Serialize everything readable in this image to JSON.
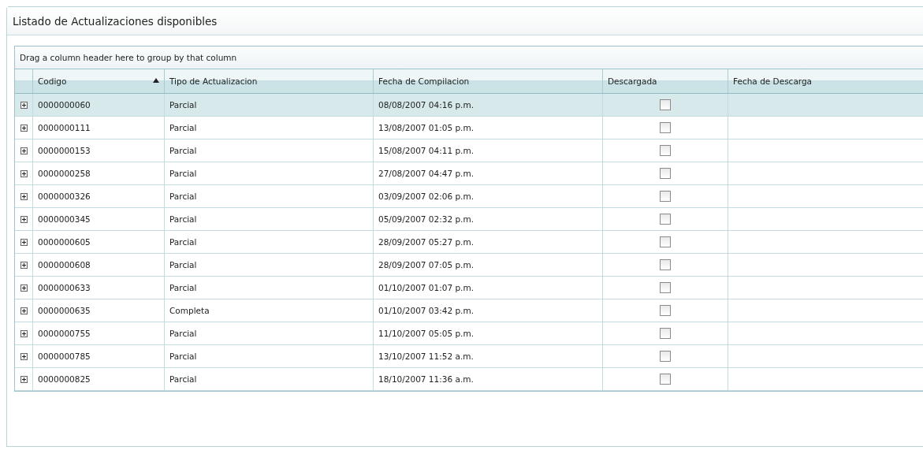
{
  "panel": {
    "title": "Listado de Actualizaciones disponibles"
  },
  "grid": {
    "group_hint": "Drag a column header here to group by that column",
    "columns": [
      {
        "label": "Codigo",
        "sorted": true
      },
      {
        "label": "Tipo de Actualizacion",
        "sorted": false
      },
      {
        "label": "Fecha de Compilacion",
        "sorted": false
      },
      {
        "label": "Descargada",
        "sorted": false
      },
      {
        "label": "Fecha de Descarga",
        "sorted": false
      }
    ],
    "rows": [
      {
        "codigo": "0000000060",
        "tipo": "Parcial",
        "fecha": "08/08/2007 04:16 p.m.",
        "descargada": false,
        "selected": true
      },
      {
        "codigo": "0000000111",
        "tipo": "Parcial",
        "fecha": "13/08/2007 01:05 p.m.",
        "descargada": false,
        "selected": false
      },
      {
        "codigo": "0000000153",
        "tipo": "Parcial",
        "fecha": "15/08/2007 04:11 p.m.",
        "descargada": false,
        "selected": false
      },
      {
        "codigo": "0000000258",
        "tipo": "Parcial",
        "fecha": "27/08/2007 04:47 p.m.",
        "descargada": false,
        "selected": false
      },
      {
        "codigo": "0000000326",
        "tipo": "Parcial",
        "fecha": "03/09/2007 02:06 p.m.",
        "descargada": false,
        "selected": false
      },
      {
        "codigo": "0000000345",
        "tipo": "Parcial",
        "fecha": "05/09/2007 02:32 p.m.",
        "descargada": false,
        "selected": false
      },
      {
        "codigo": "0000000605",
        "tipo": "Parcial",
        "fecha": "28/09/2007 05:27 p.m.",
        "descargada": false,
        "selected": false
      },
      {
        "codigo": "0000000608",
        "tipo": "Parcial",
        "fecha": "28/09/2007 07:05 p.m.",
        "descargada": false,
        "selected": false
      },
      {
        "codigo": "0000000633",
        "tipo": "Parcial",
        "fecha": "01/10/2007 01:07 p.m.",
        "descargada": false,
        "selected": false
      },
      {
        "codigo": "0000000635",
        "tipo": "Completa",
        "fecha": "01/10/2007 03:42 p.m.",
        "descargada": false,
        "selected": false
      },
      {
        "codigo": "0000000755",
        "tipo": "Parcial",
        "fecha": "11/10/2007 05:05 p.m.",
        "descargada": false,
        "selected": false
      },
      {
        "codigo": "0000000785",
        "tipo": "Parcial",
        "fecha": "13/10/2007 11:52 a.m.",
        "descargada": false,
        "selected": false
      },
      {
        "codigo": "0000000825",
        "tipo": "Parcial",
        "fecha": "18/10/2007 11:36 a.m.",
        "descargada": false,
        "selected": false
      }
    ]
  }
}
